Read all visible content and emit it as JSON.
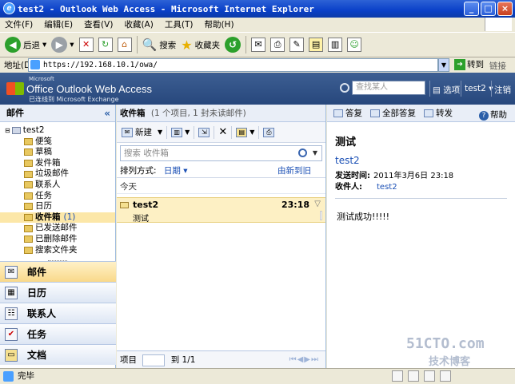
{
  "window": {
    "title": "test2 - Outlook Web Access - Microsoft Internet Explorer",
    "min": "_",
    "max": "□",
    "close": "×"
  },
  "menu": [
    "文件(F)",
    "编辑(E)",
    "查看(V)",
    "收藏(A)",
    "工具(T)",
    "帮助(H)"
  ],
  "toolbar": {
    "back": "后退",
    "search": "搜索",
    "favorites": "收藏夹"
  },
  "address": {
    "label": "地址(D)",
    "url": "https://192.168.10.1/owa/",
    "go": "转到",
    "links": "链接"
  },
  "owa": {
    "ms": "Microsoft",
    "product": "Office Outlook Web Access",
    "subtitle": "已连线到 Microsoft Exchange",
    "find_people_placeholder": "查找某人",
    "options": "选项",
    "user": "test2",
    "logout": "注销"
  },
  "left": {
    "header": "邮件",
    "tree": [
      {
        "label": "test2",
        "count": ""
      },
      {
        "label": "便笺",
        "count": ""
      },
      {
        "label": "草稿",
        "count": ""
      },
      {
        "label": "发件箱",
        "count": ""
      },
      {
        "label": "垃圾邮件",
        "count": ""
      },
      {
        "label": "联系人",
        "count": ""
      },
      {
        "label": "任务",
        "count": ""
      },
      {
        "label": "日历",
        "count": ""
      },
      {
        "label": "收件箱",
        "count": "(1)"
      },
      {
        "label": "已发送邮件",
        "count": ""
      },
      {
        "label": "已删除邮件",
        "count": ""
      },
      {
        "label": "搜索文件夹",
        "count": ""
      }
    ],
    "nav": [
      "邮件",
      "日历",
      "联系人",
      "任务",
      "文档"
    ]
  },
  "middle": {
    "folder": "收件箱",
    "count": "(1 个项目, 1 封未读邮件)",
    "new": "新建",
    "search_placeholder": "搜索 收件箱",
    "sort_label": "排列方式:",
    "sort_value": "日期",
    "sort_order": "由新到旧",
    "group": "今天",
    "messages": [
      {
        "from": "test2",
        "time": "23:18",
        "subject": "测试"
      }
    ],
    "footer_item": "项目",
    "footer_page": "到 1/1"
  },
  "reading": {
    "reply": "答复",
    "reply_all": "全部答复",
    "forward": "转发",
    "help": "帮助",
    "subject": "测试",
    "from": "test2",
    "sent_label": "发送时间:",
    "sent_value": "2011年3月6日 23:18",
    "to_label": "收件人:",
    "to_value": "test2",
    "body": "测试成功!!!!!"
  },
  "status": {
    "text": "完毕"
  },
  "watermark": {
    "l1": "51CTO.com",
    "l2": "技术博客"
  }
}
